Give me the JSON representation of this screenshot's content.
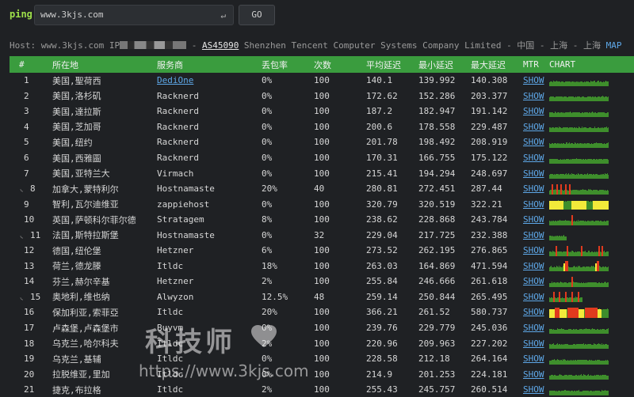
{
  "topbar": {
    "ping_label": "ping",
    "search_value": "www.3kjs.com",
    "enter_glyph": "↵",
    "go_label": "GO"
  },
  "host": {
    "prefix": "Host: www.3kjs.com IP",
    "sep1": " - ",
    "asn": "AS45090",
    "rest": " Shenzhen Tencent Computer Systems Company Limited - 中国 - 上海 - 上海 ",
    "map": "MAP"
  },
  "columns": [
    "#",
    "所在地",
    "服务商",
    "丢包率",
    "次数",
    "平均延迟",
    "最小延迟",
    "最大延迟",
    "MTR",
    "CHART"
  ],
  "rows": [
    {
      "n": "1",
      "loc": "美国,聖荷西",
      "prov": "DediOne",
      "loss": "0%",
      "count": "100",
      "avg": "140.1",
      "min": "139.992",
      "max": "140.308",
      "mtr": "SHOW",
      "chart": "steady",
      "indent": false,
      "link": true
    },
    {
      "n": "2",
      "loc": "美国,洛杉矶",
      "prov": "Racknerd",
      "loss": "0%",
      "count": "100",
      "avg": "172.62",
      "min": "152.286",
      "max": "203.377",
      "mtr": "SHOW",
      "chart": "steady",
      "indent": false,
      "link": false
    },
    {
      "n": "3",
      "loc": "美国,達拉斯",
      "prov": "Racknerd",
      "loss": "0%",
      "count": "100",
      "avg": "187.2",
      "min": "182.947",
      "max": "191.142",
      "mtr": "SHOW",
      "chart": "steady",
      "indent": false,
      "link": false
    },
    {
      "n": "4",
      "loc": "美国,芝加哥",
      "prov": "Racknerd",
      "loss": "0%",
      "count": "100",
      "avg": "200.6",
      "min": "178.558",
      "max": "229.487",
      "mtr": "SHOW",
      "chart": "steady",
      "indent": false,
      "link": false
    },
    {
      "n": "5",
      "loc": "美国,纽约",
      "prov": "Racknerd",
      "loss": "0%",
      "count": "100",
      "avg": "201.78",
      "min": "198.492",
      "max": "208.919",
      "mtr": "SHOW",
      "chart": "steady",
      "indent": false,
      "link": false
    },
    {
      "n": "6",
      "loc": "美国,西雅圖",
      "prov": "Racknerd",
      "loss": "0%",
      "count": "100",
      "avg": "170.31",
      "min": "166.755",
      "max": "175.122",
      "mtr": "SHOW",
      "chart": "steady",
      "indent": false,
      "link": false
    },
    {
      "n": "7",
      "loc": "美国,亚特兰大",
      "prov": "Virmach",
      "loss": "0%",
      "count": "100",
      "avg": "215.41",
      "min": "194.294",
      "max": "248.697",
      "mtr": "SHOW",
      "chart": "steady",
      "indent": false,
      "link": false
    },
    {
      "n": "8",
      "loc": "加拿大,蒙特利尔",
      "prov": "Hostnamaste",
      "loss": "20%",
      "count": "40",
      "avg": "280.81",
      "min": "272.451",
      "max": "287.44",
      "mtr": "SHOW",
      "chart": "loss-red",
      "indent": true,
      "link": false
    },
    {
      "n": "9",
      "loc": "智利,瓦尔迪维亚",
      "prov": "zappiehost",
      "loss": "0%",
      "count": "100",
      "avg": "320.79",
      "min": "320.519",
      "max": "322.21",
      "mtr": "SHOW",
      "chart": "yellow",
      "indent": false,
      "link": false
    },
    {
      "n": "10",
      "loc": "英国,萨顿科尔菲尔德",
      "prov": "Stratagem",
      "loss": "8%",
      "count": "100",
      "avg": "238.62",
      "min": "228.868",
      "max": "243.784",
      "mtr": "SHOW",
      "chart": "steady-red",
      "indent": false,
      "link": false
    },
    {
      "n": "11",
      "loc": "法国,斯特拉斯堡",
      "prov": "Hostnamaste",
      "loss": "0%",
      "count": "32",
      "avg": "229.04",
      "min": "217.725",
      "max": "232.388",
      "mtr": "SHOW",
      "chart": "short",
      "indent": true,
      "link": false
    },
    {
      "n": "12",
      "loc": "德国,纽伦堡",
      "prov": "Hetzner",
      "loss": "6%",
      "count": "100",
      "avg": "273.52",
      "min": "262.195",
      "max": "276.865",
      "mtr": "SHOW",
      "chart": "spiky",
      "indent": false,
      "link": false
    },
    {
      "n": "13",
      "loc": "荷兰,德龙滕",
      "prov": "Itldc",
      "loss": "18%",
      "count": "100",
      "avg": "263.03",
      "min": "164.869",
      "max": "471.594",
      "mtr": "SHOW",
      "chart": "spiky-yellow",
      "indent": false,
      "link": false
    },
    {
      "n": "14",
      "loc": "芬兰,赫尔辛基",
      "prov": "Hetzner",
      "loss": "2%",
      "count": "100",
      "avg": "255.84",
      "min": "246.666",
      "max": "261.618",
      "mtr": "SHOW",
      "chart": "steady-red",
      "indent": false,
      "link": false
    },
    {
      "n": "15",
      "loc": "奥地利,维也纳",
      "prov": "Alwyzon",
      "loss": "12.5%",
      "count": "48",
      "avg": "259.14",
      "min": "250.844",
      "max": "265.495",
      "mtr": "SHOW",
      "chart": "loss-red-short",
      "indent": true,
      "link": false
    },
    {
      "n": "16",
      "loc": "保加利亚,索菲亞",
      "prov": "Itldc",
      "loss": "20%",
      "count": "100",
      "avg": "366.21",
      "min": "261.52",
      "max": "580.737",
      "mtr": "SHOW",
      "chart": "yellow-red",
      "indent": false,
      "link": false
    },
    {
      "n": "17",
      "loc": "卢森堡,卢森堡市",
      "prov": "Buyvm",
      "loss": "0%",
      "count": "100",
      "avg": "239.76",
      "min": "229.779",
      "max": "245.036",
      "mtr": "SHOW",
      "chart": "steady",
      "indent": false,
      "link": false
    },
    {
      "n": "18",
      "loc": "乌克兰,哈尔科夫",
      "prov": "Itldc",
      "loss": "2%",
      "count": "100",
      "avg": "220.96",
      "min": "209.963",
      "max": "227.202",
      "mtr": "SHOW",
      "chart": "steady",
      "indent": false,
      "link": false
    },
    {
      "n": "19",
      "loc": "乌克兰,基辅",
      "prov": "Itldc",
      "loss": "0%",
      "count": "100",
      "avg": "228.58",
      "min": "212.18",
      "max": "264.164",
      "mtr": "SHOW",
      "chart": "steady",
      "indent": false,
      "link": false
    },
    {
      "n": "20",
      "loc": "拉脱维亚,里加",
      "prov": "Itldc",
      "loss": "0%",
      "count": "100",
      "avg": "214.9",
      "min": "201.253",
      "max": "224.181",
      "mtr": "SHOW",
      "chart": "steady",
      "indent": false,
      "link": false
    },
    {
      "n": "21",
      "loc": "捷克,布拉格",
      "prov": "Itldc",
      "loss": "2%",
      "count": "100",
      "avg": "255.43",
      "min": "245.757",
      "max": "260.514",
      "mtr": "SHOW",
      "chart": "steady",
      "indent": false,
      "link": false
    }
  ],
  "watermark": {
    "brand": "科技师",
    "url": "https://www.3kjs.com"
  },
  "colors": {
    "header_bg": "#3a9c3e",
    "link": "#5ea8e8",
    "chart_green": "#3e8e2c",
    "chart_yellow": "#f2ea3a",
    "chart_red": "#e03a1e"
  }
}
